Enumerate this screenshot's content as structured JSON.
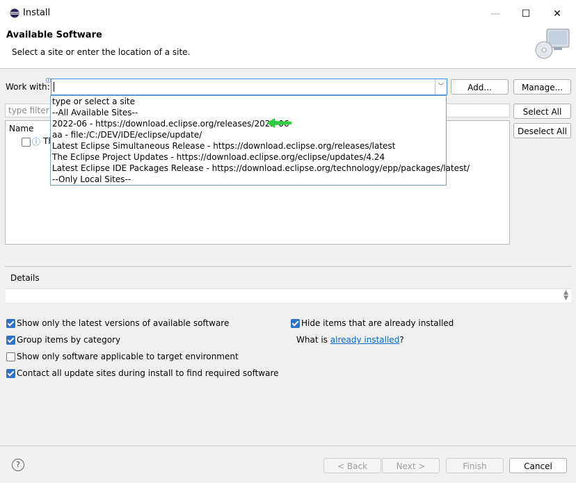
{
  "window": {
    "title": "Install",
    "minimize_glyph": "—",
    "maximize_glyph": "☐",
    "close_glyph": "✕"
  },
  "header": {
    "title": "Available Software",
    "subtitle": "Select a site or enter the location of a site."
  },
  "work_with": {
    "label": "Work with:",
    "value": "",
    "add_label": "Add...",
    "manage_label": "Manage...",
    "dropdown_items": [
      "type or select a site",
      "--All Available Sites--",
      "2022-06 - https://download.eclipse.org/releases/2022-06",
      "aa - file:/C:/DEV/IDE/eclipse/update/",
      "Latest Eclipse Simultaneous Release - https://download.eclipse.org/releases/latest",
      "The Eclipse Project Updates - https://download.eclipse.org/eclipse/updates/4.24",
      "Latest Eclipse IDE Packages Release - https://download.eclipse.org/technology/epp/packages/latest/",
      "--Only Local Sites--"
    ]
  },
  "filter": {
    "placeholder": "type filter t"
  },
  "tree": {
    "column_name": "Name",
    "row_text": "Th"
  },
  "side_buttons": {
    "select_all": "Select All",
    "deselect_all": "Deselect All"
  },
  "details": {
    "label": "Details"
  },
  "options": {
    "show_latest": {
      "label": "Show only the latest versions of available software",
      "checked": true
    },
    "group_by_category": {
      "label": "Group items by category",
      "checked": true
    },
    "target_env": {
      "label": "Show only software applicable to target environment",
      "checked": false
    },
    "contact_all": {
      "label": "Contact all update sites during install to find required software",
      "checked": true
    },
    "hide_installed": {
      "label": "Hide items that are already installed",
      "checked": true
    },
    "what_is_prefix": "What is",
    "what_is_link": "already installed",
    "what_is_suffix": "?"
  },
  "footer": {
    "back": "< Back",
    "next": "Next >",
    "finish": "Finish",
    "cancel": "Cancel",
    "help_glyph": "?"
  },
  "colors": {
    "accent": "#2f72c4",
    "link": "#0066cc",
    "annotation_arrow": "#2ecc40"
  }
}
